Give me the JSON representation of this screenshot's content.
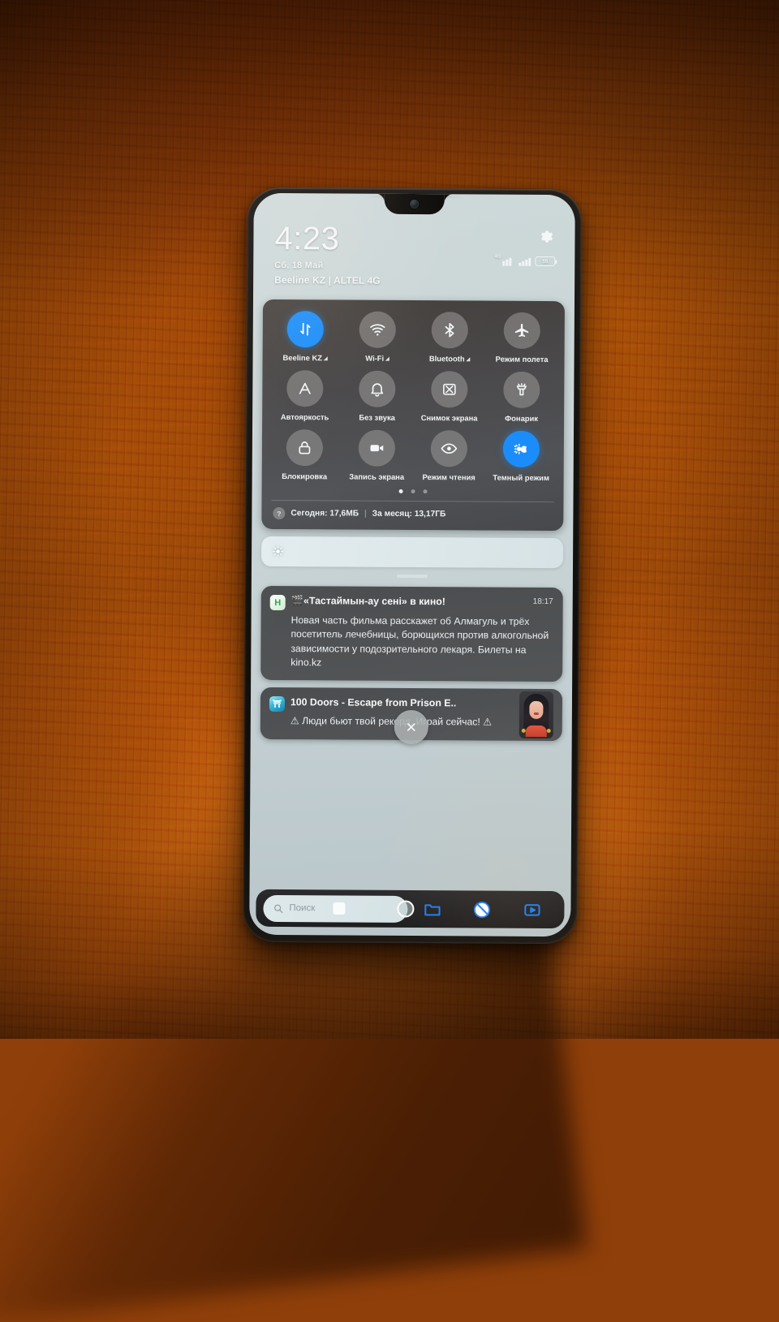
{
  "status": {
    "clock": "4:23",
    "date": "Сб, 18 Май",
    "carrier": "Beeline KZ | ALTEL 4G",
    "network_label": "4G",
    "battery_percent": "55",
    "gear_icon": "gear-icon"
  },
  "quick_settings": {
    "tiles": [
      {
        "label": "Beeline KZ",
        "icon": "mobile-data-icon",
        "active": true,
        "caret": true
      },
      {
        "label": "Wi-Fi",
        "icon": "wifi-icon",
        "active": false,
        "caret": true
      },
      {
        "label": "Bluetooth",
        "icon": "bluetooth-icon",
        "active": false,
        "caret": true
      },
      {
        "label": "Режим полета",
        "icon": "airplane-icon",
        "active": false,
        "caret": false
      },
      {
        "label": "Автояркость",
        "icon": "auto-brightness-icon",
        "active": false,
        "caret": false
      },
      {
        "label": "Без звука",
        "icon": "bell-mute-icon",
        "active": false,
        "caret": false
      },
      {
        "label": "Снимок экрана",
        "icon": "screenshot-icon",
        "active": false,
        "caret": false
      },
      {
        "label": "Фонарик",
        "icon": "flashlight-icon",
        "active": false,
        "caret": false
      },
      {
        "label": "Блокировка",
        "icon": "lock-icon",
        "active": false,
        "caret": false
      },
      {
        "label": "Запись экрана",
        "icon": "screen-record-icon",
        "active": false,
        "caret": false
      },
      {
        "label": "Режим чтения",
        "icon": "eye-icon",
        "active": false,
        "caret": false
      },
      {
        "label": "Темный режим",
        "icon": "dark-mode-icon",
        "active": true,
        "caret": false
      }
    ],
    "page_count": 3,
    "active_page": 1,
    "usage": {
      "today_label": "Сегодня: 17,6МБ",
      "month_label": "За месяц: 13,17ГБ",
      "separator": "|",
      "info_icon": "?"
    },
    "accent_color": "#1b8dfa"
  },
  "brightness": {
    "icon": "brightness-icon",
    "level_percent": 100
  },
  "notifications": [
    {
      "app_icon": "kino-app-icon",
      "app_icon_glyph": "H",
      "title": "🎬«Тастаймын-ау сені» в кино!",
      "time": "18:17",
      "body": "Новая часть фильма расскажет об Алмагуль и трёх посетитель лечебницы, борющихся против алкогольной зависимости у подозрительного лекаря. Билеты на kino.kz"
    },
    {
      "app_icon": "game-app-icon",
      "app_icon_glyph": "⛩",
      "title": "100 Doors - Escape from Prison E..",
      "time": "",
      "body": "⚠ Люди бьют твой рекорд. Играй сейчас! ⚠",
      "has_thumbnail": true,
      "thumbnail_name": "character-avatar"
    }
  ],
  "close_button": {
    "icon": "close-icon",
    "label": "✕"
  },
  "dock": {
    "search_placeholder": "Поиск",
    "search_icon": "search-icon",
    "items": [
      {
        "icon": "folder-icon",
        "color": "#1f7ff0"
      },
      {
        "icon": "voice-assistant-icon",
        "color": "#ffffff"
      },
      {
        "icon": "video-icon",
        "color": "#1f7ff0"
      }
    ]
  },
  "colors": {
    "accent": "#1b8dfa",
    "panel_bg": "#4a4d52",
    "screen_bg": "#c9d4d6",
    "wood": "#a84f09"
  }
}
